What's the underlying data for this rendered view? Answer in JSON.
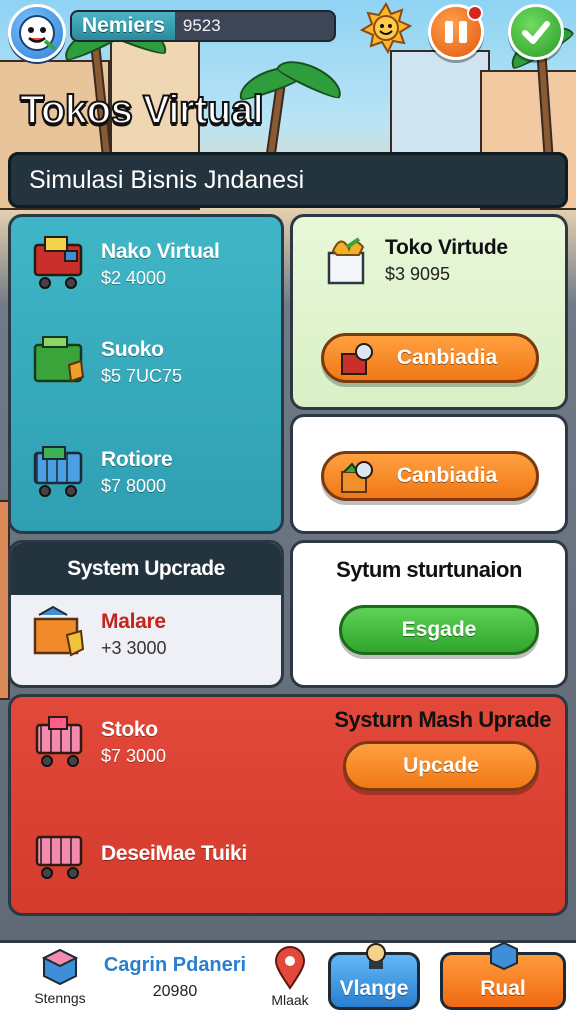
{
  "hud": {
    "bar_label": "Nemiers",
    "bar_value": "9523",
    "logo_icon": "mascot-icon",
    "sun_icon": "sun-mascot-icon",
    "pause_icon": "pause-icon",
    "confirm_icon": "checkmark-icon"
  },
  "title": "Tokos Virtual",
  "subtitle": "Simulasi Bisnis Jndanesi",
  "shop_list": [
    {
      "name": "Nako Virtual",
      "price": "$2 4000",
      "icon": "shopping-cart-icon"
    },
    {
      "name": "Suoko",
      "price": "$5 7UC75",
      "icon": "green-cart-icon"
    },
    {
      "name": "Rotiore",
      "price": "$7 8000",
      "icon": "cart-icon"
    }
  ],
  "feature_card": {
    "name": "Toko Virtude",
    "price": "$3 9095",
    "button": "Canbiadia"
  },
  "white_card": {
    "button": "Canbiadia"
  },
  "system_upgrade": {
    "header": "System Upcrade",
    "item_name": "Malare",
    "item_price": "+3 3000"
  },
  "system_structure": {
    "title": "Sytum sturtunaion",
    "button": "Esgade"
  },
  "red_panel": {
    "title": "Systurn Mash Uprade",
    "button": "Upcade",
    "item1_name": "Stoko",
    "item1_price": "$7 3000",
    "item2_name": "DeseiMae Tuiki"
  },
  "bottom_nav": {
    "settings_label": "Stenngs",
    "center_title": "Cagrin Pdaneri",
    "center_value": "20980",
    "map_label": "Mlaak",
    "blue_button": "Vlange",
    "orange_button": "Rual"
  },
  "colors": {
    "teal_panel": "#3fb6c7",
    "red_panel": "#d33b2d",
    "orange_button": "#f17816",
    "green_button": "#2fa62c",
    "dark_header": "#23343f"
  }
}
